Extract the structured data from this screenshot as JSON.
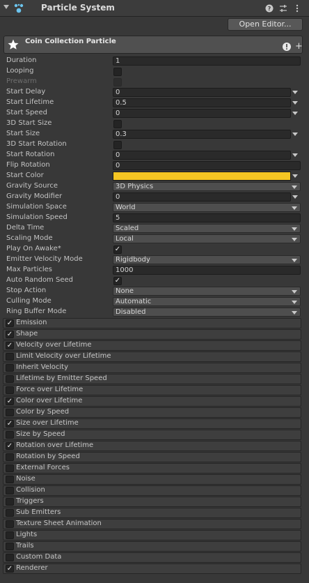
{
  "header": {
    "title": "Particle System",
    "help_icon": "help-icon",
    "settings_icon": "sliders-icon",
    "menu_icon": "kebab-icon"
  },
  "open_editor_label": "Open Editor...",
  "system": {
    "name": "Coin Collection Particle",
    "icon": "star-icon"
  },
  "labels": {
    "duration": "Duration",
    "looping": "Looping",
    "prewarm": "Prewarm",
    "start_delay": "Start Delay",
    "start_lifetime": "Start Lifetime",
    "start_speed": "Start Speed",
    "start_size_3d": "3D Start Size",
    "start_size": "Start Size",
    "start_rotation_3d": "3D Start Rotation",
    "start_rotation": "Start Rotation",
    "flip_rotation": "Flip Rotation",
    "start_color": "Start Color",
    "gravity_source": "Gravity Source",
    "gravity_modifier": "Gravity Modifier",
    "simulation_space": "Simulation Space",
    "simulation_speed": "Simulation Speed",
    "delta_time": "Delta Time",
    "scaling_mode": "Scaling Mode",
    "play_on_awake": "Play On Awake*",
    "emitter_velocity_mode": "Emitter Velocity Mode",
    "max_particles": "Max Particles",
    "auto_random_seed": "Auto Random Seed",
    "stop_action": "Stop Action",
    "culling_mode": "Culling Mode",
    "ring_buffer_mode": "Ring Buffer Mode"
  },
  "values": {
    "duration": "1",
    "start_delay": "0",
    "start_lifetime": "0.5",
    "start_speed": "0",
    "start_size": "0.3",
    "start_rotation": "0",
    "flip_rotation": "0",
    "gravity_source": "3D Physics",
    "gravity_modifier": "0",
    "simulation_space": "World",
    "simulation_speed": "5",
    "delta_time": "Scaled",
    "scaling_mode": "Local",
    "emitter_velocity_mode": "Rigidbody",
    "max_particles": "1000",
    "stop_action": "None",
    "culling_mode": "Automatic",
    "ring_buffer_mode": "Disabled",
    "start_color_hex": "#f6c623"
  },
  "checks": {
    "looping": false,
    "prewarm": false,
    "start_size_3d": false,
    "start_rotation_3d": false,
    "play_on_awake": true,
    "auto_random_seed": true
  },
  "check_mark": "✓",
  "modules": [
    {
      "label": "Emission",
      "enabled": true
    },
    {
      "label": "Shape",
      "enabled": true
    },
    {
      "label": "Velocity over Lifetime",
      "enabled": true
    },
    {
      "label": "Limit Velocity over Lifetime",
      "enabled": false
    },
    {
      "label": "Inherit Velocity",
      "enabled": false
    },
    {
      "label": "Lifetime by Emitter Speed",
      "enabled": false
    },
    {
      "label": "Force over Lifetime",
      "enabled": false
    },
    {
      "label": "Color over Lifetime",
      "enabled": true
    },
    {
      "label": "Color by Speed",
      "enabled": false
    },
    {
      "label": "Size over Lifetime",
      "enabled": true
    },
    {
      "label": "Size by Speed",
      "enabled": false
    },
    {
      "label": "Rotation over Lifetime",
      "enabled": true
    },
    {
      "label": "Rotation by Speed",
      "enabled": false
    },
    {
      "label": "External Forces",
      "enabled": false
    },
    {
      "label": "Noise",
      "enabled": false
    },
    {
      "label": "Collision",
      "enabled": false
    },
    {
      "label": "Triggers",
      "enabled": false
    },
    {
      "label": "Sub Emitters",
      "enabled": false
    },
    {
      "label": "Texture Sheet Animation",
      "enabled": false
    },
    {
      "label": "Lights",
      "enabled": false
    },
    {
      "label": "Trails",
      "enabled": false
    },
    {
      "label": "Custom Data",
      "enabled": false
    },
    {
      "label": "Renderer",
      "enabled": true
    }
  ]
}
